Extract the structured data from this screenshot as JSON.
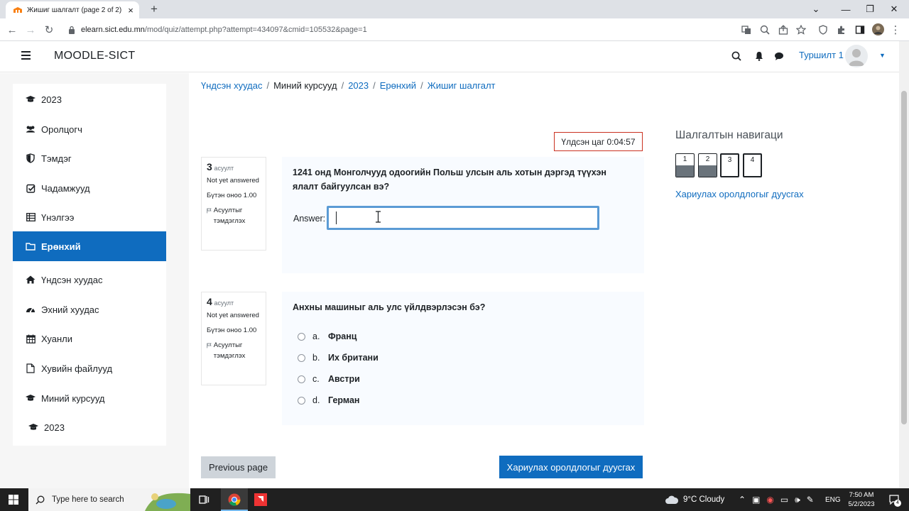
{
  "browser": {
    "tab_title": "Жишиг шалгалт (page 2 of 2)",
    "new_tab": "+",
    "url_host": "elearn.sict.edu.mn",
    "url_path": "/mod/quiz/attempt.php?attempt=434097&cmid=105532&page=1"
  },
  "header": {
    "site_name": "MOODLE-SICT",
    "user_name": "Туршилт 1"
  },
  "sidebar": {
    "items": [
      {
        "label": "2023",
        "icon": "graduation-cap-icon"
      },
      {
        "label": "Оролцогч",
        "icon": "users-icon"
      },
      {
        "label": "Тэмдэг",
        "icon": "shield-icon"
      },
      {
        "label": "Чадамжууд",
        "icon": "checkbox-icon"
      },
      {
        "label": "Үнэлгээ",
        "icon": "table-icon"
      },
      {
        "label": "Ерөнхий",
        "icon": "folder-icon",
        "active": true
      },
      {
        "label": "Үндсэн хуудас",
        "icon": "home-icon"
      },
      {
        "label": "Эхний хуудас",
        "icon": "dashboard-icon"
      },
      {
        "label": "Хуанли",
        "icon": "calendar-icon"
      },
      {
        "label": "Хувийн файлууд",
        "icon": "file-icon"
      },
      {
        "label": "Миний курсууд",
        "icon": "graduation-cap-icon"
      },
      {
        "label": "2023",
        "icon": "graduation-cap-icon"
      }
    ]
  },
  "breadcrumb": [
    "Үндсэн хуудас",
    "Миний курсууд",
    "2023",
    "Ерөнхий",
    "Жишиг шалгалт"
  ],
  "timer": "Үлдсэн цаг 0:04:57",
  "questions": [
    {
      "number": "3",
      "label": "асуулт",
      "status": "Not yet answered",
      "grade": "Бүтэн оноо 1.00",
      "flag": "Асуултыг тэмдэглэх",
      "text": "1241 онд Монголчууд одоогийн Польш улсын аль хотын дэргэд түүхэн ялалт байгуулсан вэ?",
      "answer_label": "Answer:",
      "answer_value": ""
    },
    {
      "number": "4",
      "label": "асуулт",
      "status": "Not yet answered",
      "grade": "Бүтэн оноо 1.00",
      "flag": "Асуултыг тэмдэглэх",
      "text": "Анхны машиныг аль улс үйлдвэрлэсэн бэ?",
      "options": [
        {
          "letter": "a.",
          "text": "Франц"
        },
        {
          "letter": "b.",
          "text": "Их британи"
        },
        {
          "letter": "c.",
          "text": "Австри"
        },
        {
          "letter": "d.",
          "text": "Герман"
        }
      ]
    }
  ],
  "buttons": {
    "previous": "Previous page",
    "finish": "Хариулах оролдлогыг дуусгах"
  },
  "quiz_nav": {
    "title": "Шалгалтын навигаци",
    "items": [
      {
        "label": "1",
        "answered": true
      },
      {
        "label": "2",
        "answered": true
      },
      {
        "label": "3",
        "answered": false
      },
      {
        "label": "4",
        "answered": false,
        "current": true
      }
    ],
    "finish_link": "Хариулах оролдлогыг дуусгах"
  },
  "taskbar": {
    "search_placeholder": "Type here to search",
    "weather": "9°C  Cloudy",
    "lang": "ENG",
    "time": "7:50 AM",
    "date": "5/2/2023",
    "notifications": "4"
  },
  "colors": {
    "accent": "#0f6cbf",
    "timer_border": "#ca3120",
    "question_bg": "#f8fbff"
  }
}
